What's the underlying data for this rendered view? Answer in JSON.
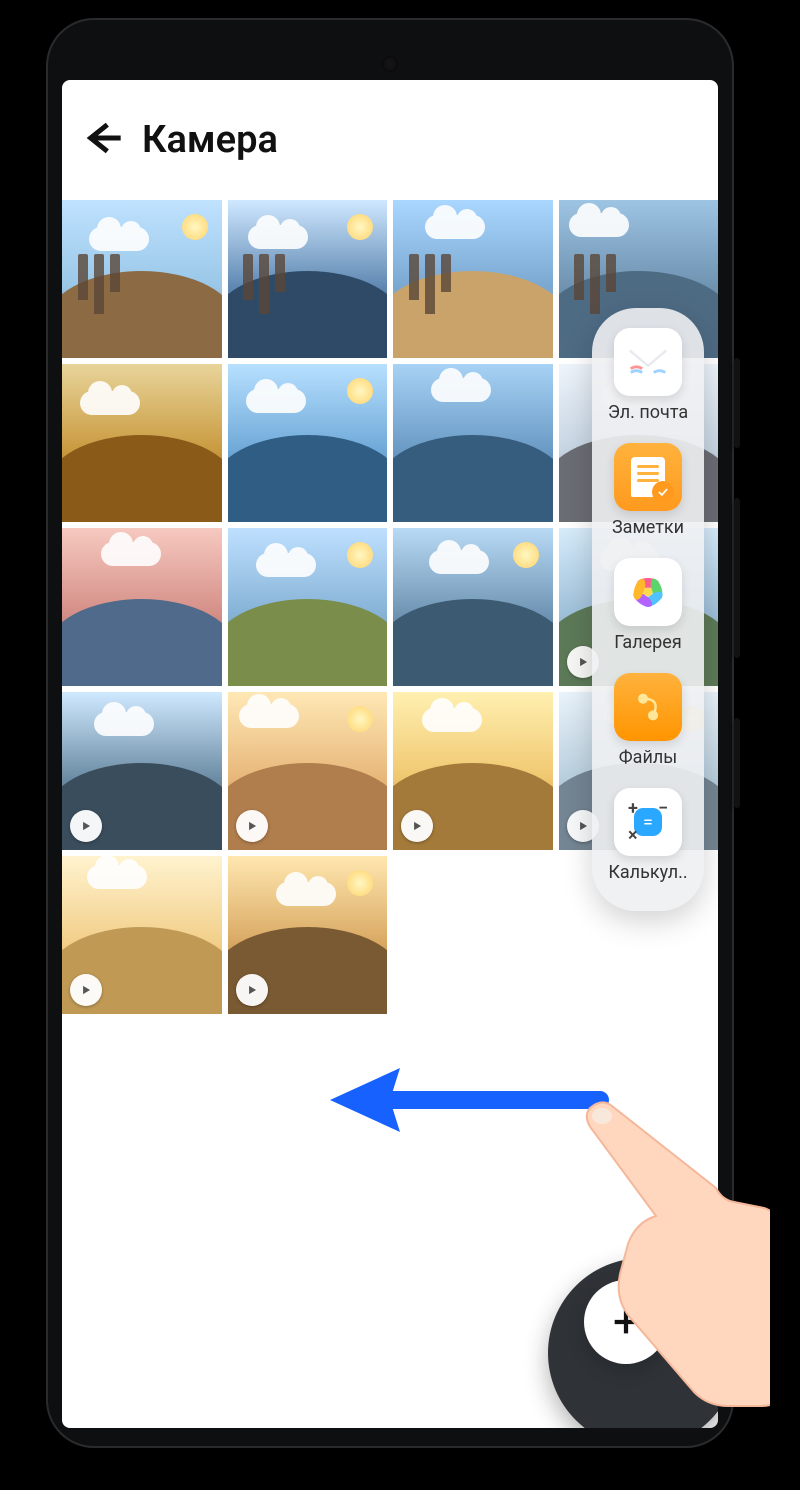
{
  "header": {
    "title": "Камера"
  },
  "gallery": {
    "columns": 4,
    "thumbs": [
      {
        "video": false,
        "sky": "#bfe2ff",
        "mid": "#9ac7e8",
        "fg": "#8b6a44"
      },
      {
        "video": false,
        "sky": "#cfe8ff",
        "mid": "#5f88b2",
        "fg": "#2e4a66"
      },
      {
        "video": false,
        "sky": "#a9d7ff",
        "mid": "#7aa8d1",
        "fg": "#c9a36a"
      },
      {
        "video": false,
        "sky": "#9ec4e4",
        "mid": "#6f93b1",
        "fg": "#4e6b84"
      },
      {
        "video": false,
        "sky": "#e8d49a",
        "mid": "#c99a3f",
        "fg": "#8a5a18"
      },
      {
        "video": false,
        "sky": "#b7e0ff",
        "mid": "#6fa9d8",
        "fg": "#2f5d84"
      },
      {
        "video": false,
        "sky": "#a7d2f5",
        "mid": "#6a9ac5",
        "fg": "#365c7e"
      },
      {
        "video": false,
        "sky": "#eef4fb",
        "mid": "#c7d5e3",
        "fg": "#6a6d73"
      },
      {
        "video": false,
        "sky": "#f6c9c0",
        "mid": "#d48e86",
        "fg": "#4f6a8a"
      },
      {
        "video": false,
        "sky": "#bfe0ff",
        "mid": "#85b2d6",
        "fg": "#7a8d4a"
      },
      {
        "video": false,
        "sky": "#b8daf5",
        "mid": "#6f94b3",
        "fg": "#3d5a73"
      },
      {
        "video": true,
        "sky": "#d7ecfb",
        "mid": "#9ec0d9",
        "fg": "#5d7a58"
      },
      {
        "video": true,
        "sky": "#cfe9ff",
        "mid": "#6b8ca4",
        "fg": "#3a4d5d"
      },
      {
        "video": true,
        "sky": "#ffe8b5",
        "mid": "#e7b77a",
        "fg": "#b07d4c"
      },
      {
        "video": true,
        "sky": "#fff0b0",
        "mid": "#f0c770",
        "fg": "#a37a3a"
      },
      {
        "video": true,
        "sky": "#e9f3fb",
        "mid": "#b9cfde",
        "fg": "#748593"
      },
      {
        "video": true,
        "sky": "#fff3cf",
        "mid": "#f2cf8a",
        "fg": "#c09a55"
      },
      {
        "video": true,
        "sky": "#ffe7b0",
        "mid": "#d9a963",
        "fg": "#7a5a33"
      }
    ]
  },
  "dock": {
    "items": [
      {
        "icon": "mail",
        "label": "Эл. почта"
      },
      {
        "icon": "notes",
        "label": "Заметки"
      },
      {
        "icon": "gallery",
        "label": "Галерея"
      },
      {
        "icon": "files",
        "label": "Файлы"
      },
      {
        "icon": "calc",
        "label": "Калькул.."
      }
    ]
  },
  "gesture": {
    "direction": "left"
  }
}
